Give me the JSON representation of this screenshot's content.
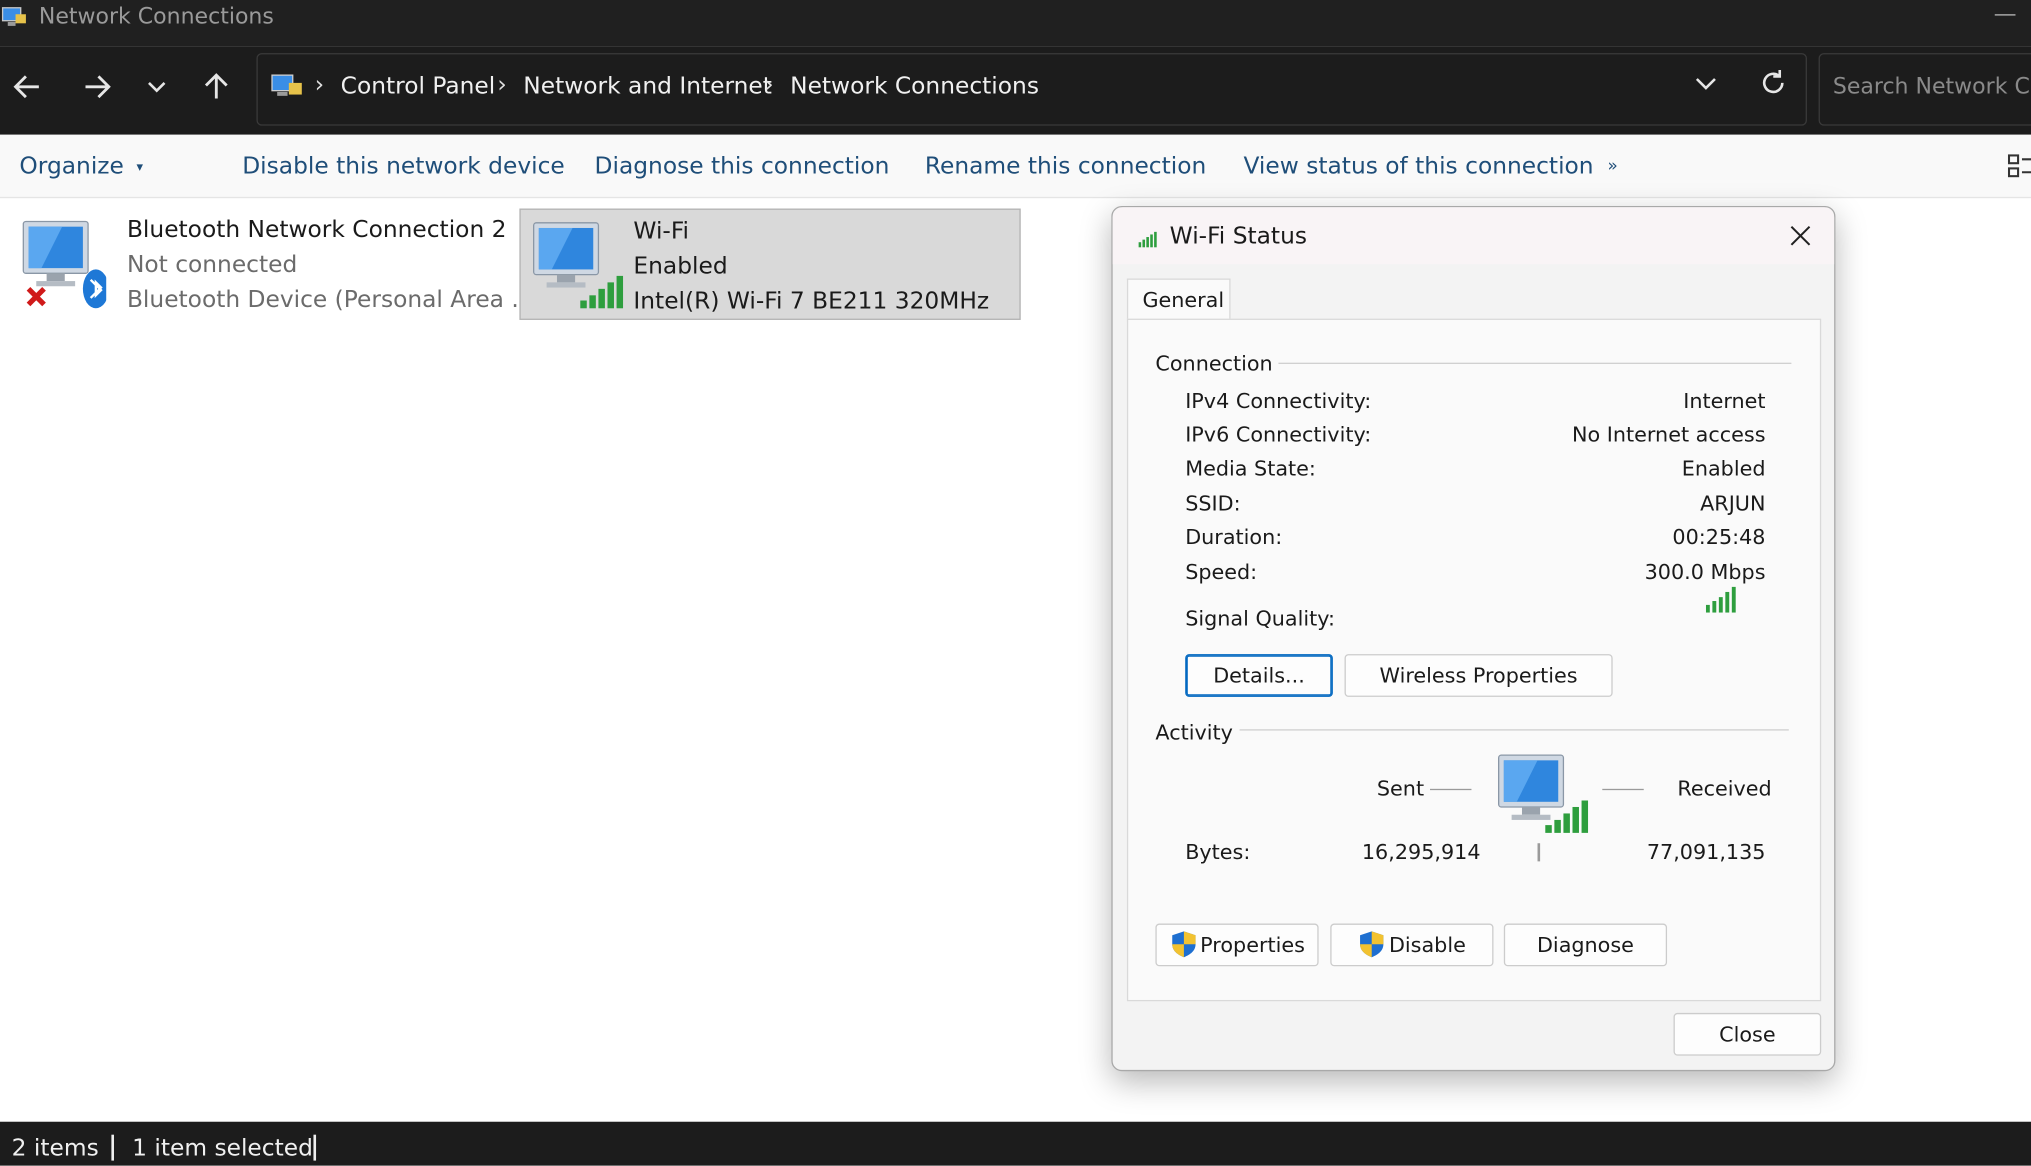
{
  "window": {
    "title": "Network Connections"
  },
  "nav": {
    "breadcrumbs": [
      "Control Panel",
      "Network and Internet",
      "Network Connections"
    ],
    "search_placeholder": "Search Network Co"
  },
  "toolbar": {
    "organize": "Organize",
    "disable": "Disable this network device",
    "diagnose": "Diagnose this connection",
    "rename": "Rename this connection",
    "view_status": "View status of this connection",
    "more": "»"
  },
  "items": [
    {
      "name": "Bluetooth Network Connection 2",
      "status": "Not connected",
      "device": "Bluetooth Device (Personal Area ...",
      "selected": false
    },
    {
      "name": "Wi-Fi",
      "status": "Enabled",
      "device": "Intel(R) Wi-Fi 7 BE211 320MHz",
      "selected": true
    }
  ],
  "statusbar": {
    "count": "2 items",
    "selected": "1 item selected"
  },
  "dialog": {
    "title": "Wi-Fi Status",
    "tab": "General",
    "connection": {
      "heading": "Connection",
      "rows": [
        {
          "label": "IPv4 Connectivity:",
          "value": "Internet"
        },
        {
          "label": "IPv6 Connectivity:",
          "value": "No Internet access"
        },
        {
          "label": "Media State:",
          "value": "Enabled"
        },
        {
          "label": "SSID:",
          "value": "ARJUN"
        },
        {
          "label": "Duration:",
          "value": "00:25:48"
        },
        {
          "label": "Speed:",
          "value": "300.0 Mbps"
        }
      ],
      "signal_label": "Signal Quality:",
      "signal_bars": 5
    },
    "buttons": {
      "details": "Details...",
      "wireless": "Wireless Properties"
    },
    "activity": {
      "heading": "Activity",
      "sent_label": "Sent",
      "received_label": "Received",
      "bytes_label": "Bytes:",
      "bytes_sent": "16,295,914",
      "bytes_received": "77,091,135"
    },
    "actions": {
      "properties": "Properties",
      "disable": "Disable",
      "diagnose": "Diagnose"
    },
    "close": "Close"
  }
}
